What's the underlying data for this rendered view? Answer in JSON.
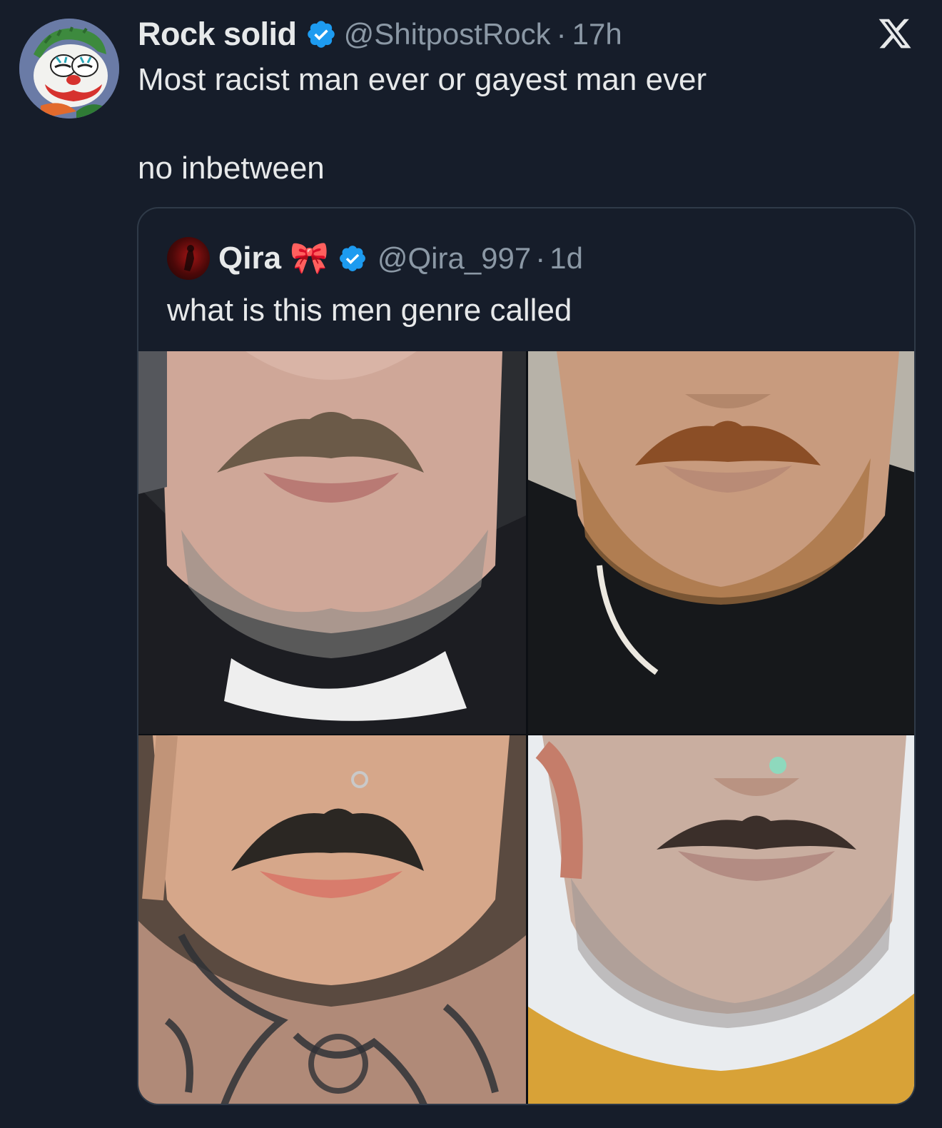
{
  "tweet": {
    "display_name": "Rock solid",
    "handle": "@ShitpostRock",
    "separator": "·",
    "age": "17h",
    "text_line1": "Most racist man ever or gayest man ever",
    "text_line2": "no inbetween",
    "avatar_icon": "clown-cat-avatar",
    "verified_icon": "verified-badge-icon",
    "brand_icon": "x-logo-icon"
  },
  "quoted": {
    "display_name": "Qira",
    "emoji": "🎀",
    "handle": "@Qira_997",
    "separator": "·",
    "age": "1d",
    "text": "what is this men genre called",
    "images": [
      {
        "name": "photo-mustache-1"
      },
      {
        "name": "photo-mustache-2"
      },
      {
        "name": "photo-mustache-3"
      },
      {
        "name": "photo-mustache-4"
      }
    ]
  },
  "colors": {
    "background": "#161d2a",
    "text_primary": "#e7e9ea",
    "text_secondary": "#8b98a5",
    "verified_blue": "#1d9bf0",
    "border": "#2f3a48"
  }
}
